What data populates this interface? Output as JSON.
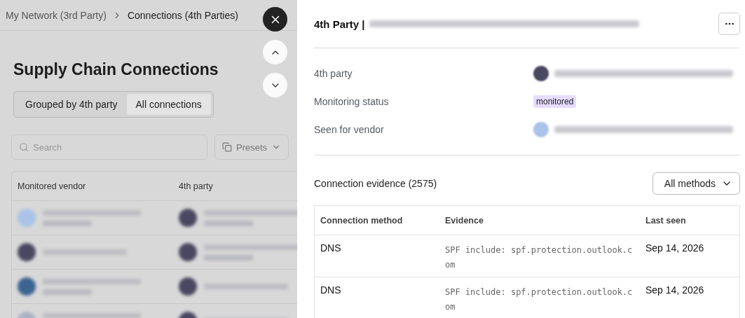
{
  "breadcrumb": [
    {
      "label": "My Network (3rd Party)",
      "current": false
    },
    {
      "label": "Connections (4th Parties)",
      "current": true
    }
  ],
  "page_title": "Supply Chain Connections",
  "view_toggle": [
    {
      "label": "Grouped by 4th party",
      "selected": false
    },
    {
      "label": "All connections",
      "selected": true
    }
  ],
  "search": {
    "placeholder": "Search"
  },
  "presets_button": "Presets",
  "table": {
    "columns": [
      "Monitored vendor",
      "4th party"
    ],
    "rows": [
      {
        "vendor": {
          "kind": "two-line",
          "color": "#a9c4e8"
        },
        "party": {
          "kind": "two-line",
          "color": "#4a4860"
        }
      },
      {
        "vendor": {
          "kind": "one-line",
          "color": "#4a4860"
        },
        "party": {
          "kind": "two-line",
          "color": "#4a4860"
        }
      },
      {
        "vendor": {
          "kind": "two-line",
          "color": "#3d6491"
        },
        "party": {
          "kind": "one-line",
          "color": "#4a4860"
        }
      },
      {
        "vendor": {
          "kind": "two-line",
          "color": "#aab3c2"
        },
        "party": {
          "kind": "one-line",
          "color": "#4a4860"
        }
      }
    ]
  },
  "panel": {
    "title": "4th Party |",
    "details": [
      {
        "label": "4th party",
        "kind": "entity",
        "color": "#4a4860"
      },
      {
        "label": "Monitoring status",
        "kind": "badge",
        "value": "monitored"
      },
      {
        "label": "Seen for vendor",
        "kind": "entity",
        "color": "#a9c4e8"
      }
    ],
    "evidence_title": "Connection evidence (2575)",
    "method_filter": "All methods",
    "evidence_table": {
      "columns": [
        "Connection method",
        "Evidence",
        "Last seen"
      ],
      "rows": [
        {
          "method": "DNS",
          "evidence": "SPF include: spf.protection.outlook.com",
          "last_seen": "Sep 14, 2026"
        },
        {
          "method": "DNS",
          "evidence": "SPF include: spf.protection.outlook.com",
          "last_seen": "Sep 14, 2026"
        }
      ]
    }
  }
}
